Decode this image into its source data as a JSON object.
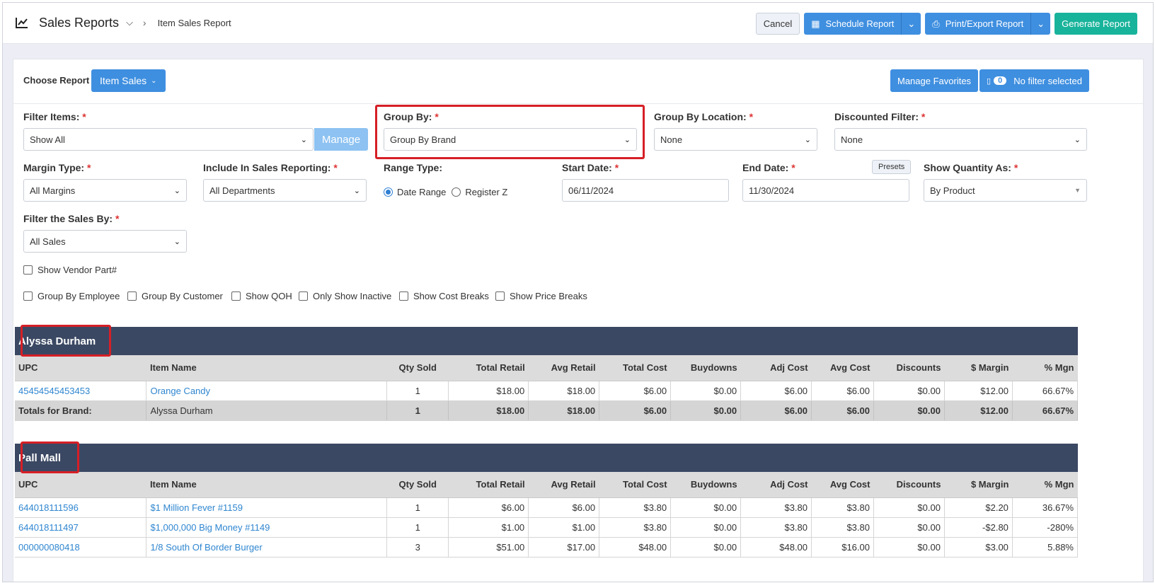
{
  "header": {
    "app_title": "Sales Reports",
    "breadcrumb_current": "Item Sales Report",
    "cancel_label": "Cancel",
    "schedule_label": "Schedule Report",
    "print_label": "Print/Export Report",
    "generate_label": "Generate Report"
  },
  "toolbar": {
    "choose_report_label": "Choose Report",
    "report_selected": "Item Sales",
    "manage_favorites_label": "Manage Favorites",
    "filter_count": "0",
    "filter_status": "No filter selected"
  },
  "form": {
    "filter_items": {
      "label": "Filter Items:",
      "value": "Show All",
      "manage_label": "Manage"
    },
    "group_by": {
      "label": "Group By:",
      "value": "Group By Brand"
    },
    "group_by_location": {
      "label": "Group By Location:",
      "value": "None"
    },
    "discounted_filter": {
      "label": "Discounted Filter:",
      "value": "None"
    },
    "margin_type": {
      "label": "Margin Type:",
      "value": "All Margins"
    },
    "include_in_sales": {
      "label": "Include In Sales Reporting:",
      "value": "All Departments"
    },
    "range_type": {
      "label": "Range Type:",
      "option1": "Date Range",
      "option2": "Register Z"
    },
    "start_date": {
      "label": "Start Date:",
      "value": "06/11/2024"
    },
    "end_date": {
      "label": "End Date:",
      "value": "11/30/2024",
      "presets_label": "Presets"
    },
    "show_quantity_as": {
      "label": "Show Quantity As:",
      "value": "By Product"
    },
    "filter_sales_by": {
      "label": "Filter the Sales By:",
      "value": "All Sales"
    },
    "req_mark": "*"
  },
  "checkboxes": {
    "vendor_part": "Show Vendor Part#",
    "group_employee": "Group By Employee",
    "group_customer": "Group By Customer",
    "show_qoh": "Show QOH",
    "only_inactive": "Only Show Inactive",
    "cost_breaks": "Show Cost Breaks",
    "price_breaks": "Show Price Breaks"
  },
  "table_headers": [
    "UPC",
    "Item Name",
    "Qty Sold",
    "Total Retail",
    "Avg Retail",
    "Total Cost",
    "Buydowns",
    "Adj Cost",
    "Avg Cost",
    "Discounts",
    "$ Margin",
    "% Mgn"
  ],
  "groups": [
    {
      "name": "Alyssa Durham",
      "rows": [
        [
          "45454545453453",
          "Orange Candy",
          "1",
          "$18.00",
          "$18.00",
          "$6.00",
          "$0.00",
          "$6.00",
          "$6.00",
          "$0.00",
          "$12.00",
          "66.67%"
        ]
      ],
      "totals": [
        "Totals for Brand:",
        "Alyssa Durham",
        "1",
        "$18.00",
        "$18.00",
        "$6.00",
        "$0.00",
        "$6.00",
        "$6.00",
        "$0.00",
        "$12.00",
        "66.67%"
      ]
    },
    {
      "name": "Pall Mall",
      "rows": [
        [
          "644018111596",
          "$1 Million Fever #1159",
          "1",
          "$6.00",
          "$6.00",
          "$3.80",
          "$0.00",
          "$3.80",
          "$3.80",
          "$0.00",
          "$2.20",
          "36.67%"
        ],
        [
          "644018111497",
          "$1,000,000 Big Money #1149",
          "1",
          "$1.00",
          "$1.00",
          "$3.80",
          "$0.00",
          "$3.80",
          "$3.80",
          "$0.00",
          "-$2.80",
          "-280%"
        ],
        [
          "000000080418",
          "1/8 South Of Border Burger",
          "3",
          "$51.00",
          "$17.00",
          "$48.00",
          "$0.00",
          "$48.00",
          "$16.00",
          "$0.00",
          "$3.00",
          "5.88%"
        ]
      ]
    }
  ]
}
